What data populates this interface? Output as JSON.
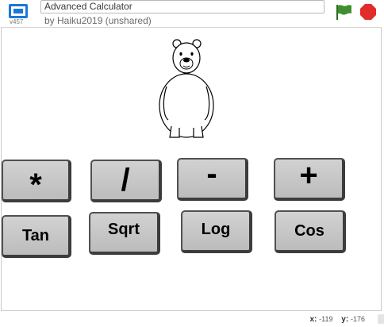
{
  "header": {
    "version": "v457",
    "project_title": "Advanced Calculator",
    "byline": "by Haiku2019 (unshared)"
  },
  "colors": {
    "accent": "#1b78d8",
    "flag": "#3f8f2f",
    "stop": "#e22b2b",
    "button_face": "#c8c8c8",
    "button_border": "#3c3c3c"
  },
  "icons": {
    "fullscreen": "fullscreen-icon",
    "flag": "green-flag-icon",
    "stop": "stop-icon",
    "sprite": "polar-bear-sprite"
  },
  "buttons": {
    "multiply": "*",
    "divide": "/",
    "subtract": "-",
    "add": "+",
    "tan": "Tan",
    "sqrt": "Sqrt",
    "log": "Log",
    "cos": "Cos"
  },
  "footer": {
    "x_label": "x:",
    "x_value": "-119",
    "y_label": "y:",
    "y_value": "-176"
  }
}
